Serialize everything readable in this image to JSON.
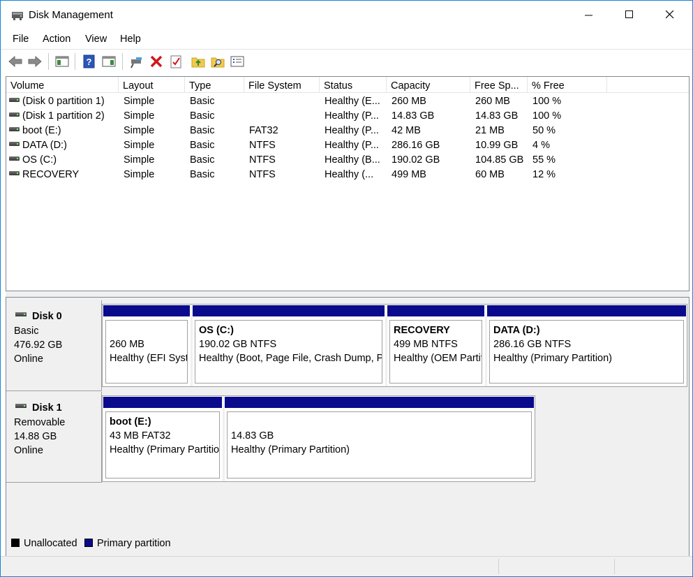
{
  "window": {
    "title": "Disk Management"
  },
  "menu": [
    "File",
    "Action",
    "View",
    "Help"
  ],
  "toolbar": {
    "icons": [
      "back-arrow-icon",
      "forward-arrow-icon",
      "console-tree-icon",
      "help-icon",
      "show-hide-pane-icon",
      "connect-disk-icon",
      "delete-icon",
      "checklist-icon",
      "up-folder-icon",
      "search-folder-icon",
      "properties-list-icon"
    ]
  },
  "volumes": {
    "columns": [
      "Volume",
      "Layout",
      "Type",
      "File System",
      "Status",
      "Capacity",
      "Free Sp...",
      "% Free"
    ],
    "rows": [
      [
        "(Disk 0 partition 1)",
        "Simple",
        "Basic",
        "",
        "Healthy (E...",
        "260 MB",
        "260 MB",
        "100 %"
      ],
      [
        "(Disk 1 partition 2)",
        "Simple",
        "Basic",
        "",
        "Healthy (P...",
        "14.83 GB",
        "14.83 GB",
        "100 %"
      ],
      [
        "boot (E:)",
        "Simple",
        "Basic",
        "FAT32",
        "Healthy (P...",
        "42 MB",
        "21 MB",
        "50 %"
      ],
      [
        "DATA (D:)",
        "Simple",
        "Basic",
        "NTFS",
        "Healthy (P...",
        "286.16 GB",
        "10.99 GB",
        "4 %"
      ],
      [
        "OS (C:)",
        "Simple",
        "Basic",
        "NTFS",
        "Healthy (B...",
        "190.02 GB",
        "104.85 GB",
        "55 %"
      ],
      [
        "RECOVERY",
        "Simple",
        "Basic",
        "NTFS",
        "Healthy (...",
        "499 MB",
        "60 MB",
        "12 %"
      ]
    ]
  },
  "disks": [
    {
      "name": "Disk 0",
      "type": "Basic",
      "size": "476.92 GB",
      "state": "Online",
      "partitions": [
        {
          "title": "",
          "size": "260 MB",
          "status": "Healthy (EFI System Partition)"
        },
        {
          "title": "OS  (C:)",
          "size": "190.02 GB NTFS",
          "status": "Healthy (Boot, Page File, Crash Dump, Primary Partition)"
        },
        {
          "title": "RECOVERY",
          "size": "499 MB NTFS",
          "status": "Healthy (OEM Partition)"
        },
        {
          "title": "DATA  (D:)",
          "size": "286.16 GB NTFS",
          "status": "Healthy (Primary Partition)"
        }
      ]
    },
    {
      "name": "Disk 1",
      "type": "Removable",
      "size": "14.88 GB",
      "state": "Online",
      "partitions": [
        {
          "title": "boot  (E:)",
          "size": "43 MB FAT32",
          "status": "Healthy (Primary Partition)"
        },
        {
          "title": "",
          "size": "14.83 GB",
          "status": "Healthy (Primary Partition)"
        }
      ]
    }
  ],
  "legend": [
    {
      "label": "Unallocated",
      "color": "#000000"
    },
    {
      "label": "Primary partition",
      "color": "#0a0a8c"
    }
  ]
}
